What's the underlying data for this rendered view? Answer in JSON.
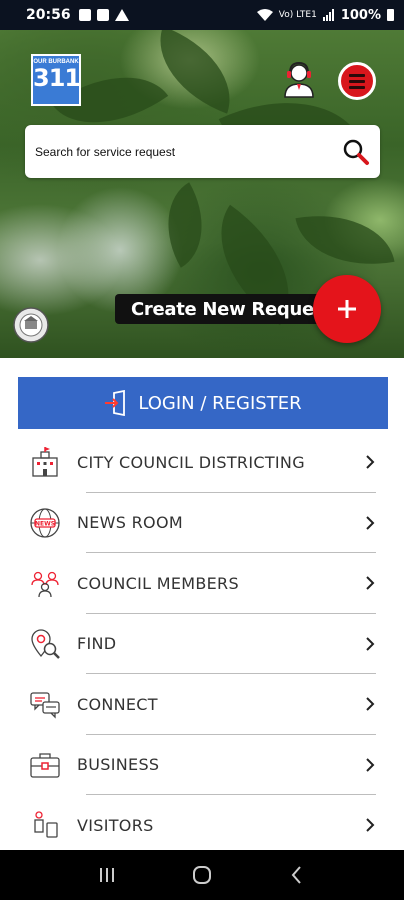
{
  "status_bar": {
    "time": "20:56",
    "battery": "100%",
    "signal_text": "Vo) LTE1"
  },
  "header": {
    "logo_text_top": "OUR BURBANK",
    "logo_number": "311",
    "logo_color": "#3a7bd5"
  },
  "search": {
    "placeholder": "Search for service request"
  },
  "create_request": {
    "label": "Create New Request",
    "fab_color": "#e4141b"
  },
  "login": {
    "label": "LOGIN / REGISTER",
    "color": "#3567c6"
  },
  "menu_items": [
    {
      "label": "CITY COUNCIL DISTRICTING",
      "icon": "building-icon"
    },
    {
      "label": "NEWS ROOM",
      "icon": "news-globe-icon"
    },
    {
      "label": "COUNCIL MEMBERS",
      "icon": "council-members-icon"
    },
    {
      "label": "FIND",
      "icon": "find-location-icon"
    },
    {
      "label": "CONNECT",
      "icon": "chat-bubbles-icon"
    },
    {
      "label": "BUSINESS",
      "icon": "briefcase-icon"
    },
    {
      "label": "VISITORS",
      "icon": "visitors-icon"
    }
  ]
}
